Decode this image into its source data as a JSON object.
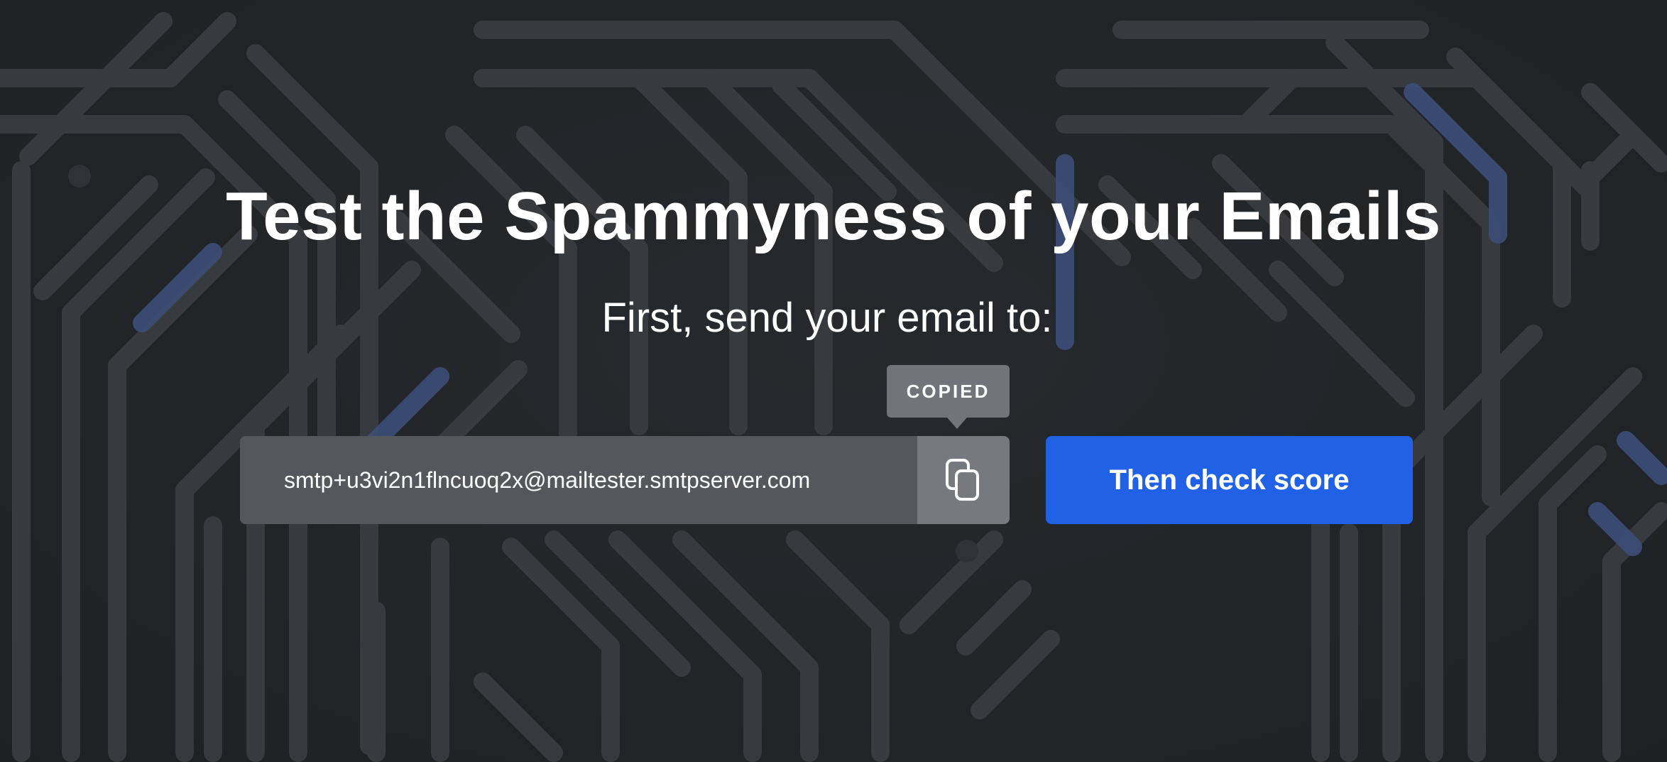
{
  "hero": {
    "title": "Test the Spammyness of your Emails",
    "subtitle": "First, send your email to:"
  },
  "email": {
    "address": "smtp+u3vi2n1flncuoq2x@mailtester.smtpserver.com"
  },
  "copy": {
    "icon": "copy-icon",
    "tooltip": "COPIED"
  },
  "cta": {
    "label": "Then check score"
  },
  "colors": {
    "background": "#222528",
    "accent": "#2161e5",
    "input_bg": "#54575b",
    "copy_bg": "#76797d",
    "trace": "#3a3d41",
    "trace_blue": "#3c4e78"
  }
}
